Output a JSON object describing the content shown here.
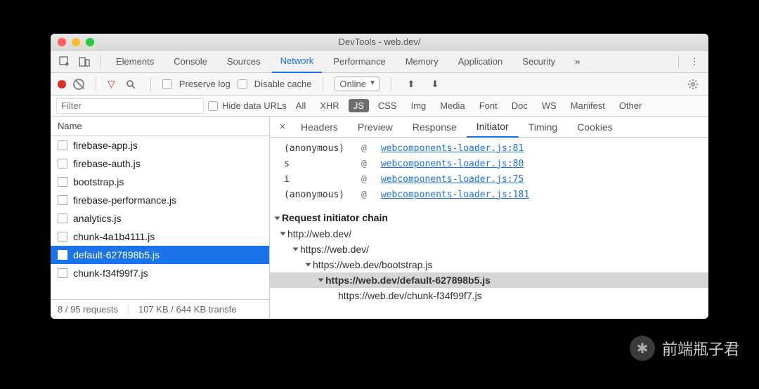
{
  "window": {
    "title": "DevTools - web.dev/"
  },
  "panelTabs": [
    "Elements",
    "Console",
    "Sources",
    "Network",
    "Performance",
    "Memory",
    "Application",
    "Security"
  ],
  "panelActive": "Network",
  "toolbar": {
    "preserve": "Preserve log",
    "disable": "Disable cache",
    "throttle": "Online"
  },
  "filterbar": {
    "placeholder": "Filter",
    "hide": "Hide data URLs",
    "types": [
      "All",
      "XHR",
      "JS",
      "CSS",
      "Img",
      "Media",
      "Font",
      "Doc",
      "WS",
      "Manifest",
      "Other"
    ],
    "typeActive": "JS"
  },
  "nameHeader": "Name",
  "requests": [
    "firebase-app.js",
    "firebase-auth.js",
    "bootstrap.js",
    "firebase-performance.js",
    "analytics.js",
    "chunk-4a1b4111.js",
    "default-627898b5.js",
    "chunk-f34f99f7.js"
  ],
  "requestSelected": "default-627898b5.js",
  "status": {
    "requests": "8 / 95 requests",
    "transfer": "107 KB / 644 KB transfe"
  },
  "detailTabs": [
    "Headers",
    "Preview",
    "Response",
    "Initiator",
    "Timing",
    "Cookies"
  ],
  "detailActive": "Initiator",
  "stack": [
    {
      "fn": "(anonymous)",
      "loc": "webcomponents-loader.js:81"
    },
    {
      "fn": "s",
      "loc": "webcomponents-loader.js:80"
    },
    {
      "fn": "i",
      "loc": "webcomponents-loader.js:75"
    },
    {
      "fn": "(anonymous)",
      "loc": "webcomponents-loader.js:181"
    }
  ],
  "chainHeader": "Request initiator chain",
  "chain": [
    {
      "indent": 0,
      "url": "http://web.dev/",
      "hl": false
    },
    {
      "indent": 1,
      "url": "https://web.dev/",
      "hl": false
    },
    {
      "indent": 2,
      "url": "https://web.dev/bootstrap.js",
      "hl": false
    },
    {
      "indent": 3,
      "url": "https://web.dev/default-627898b5.js",
      "hl": true
    },
    {
      "indent": 4,
      "url": "https://web.dev/chunk-f34f99f7.js",
      "hl": false
    }
  ],
  "watermark": "前端瓶子君"
}
